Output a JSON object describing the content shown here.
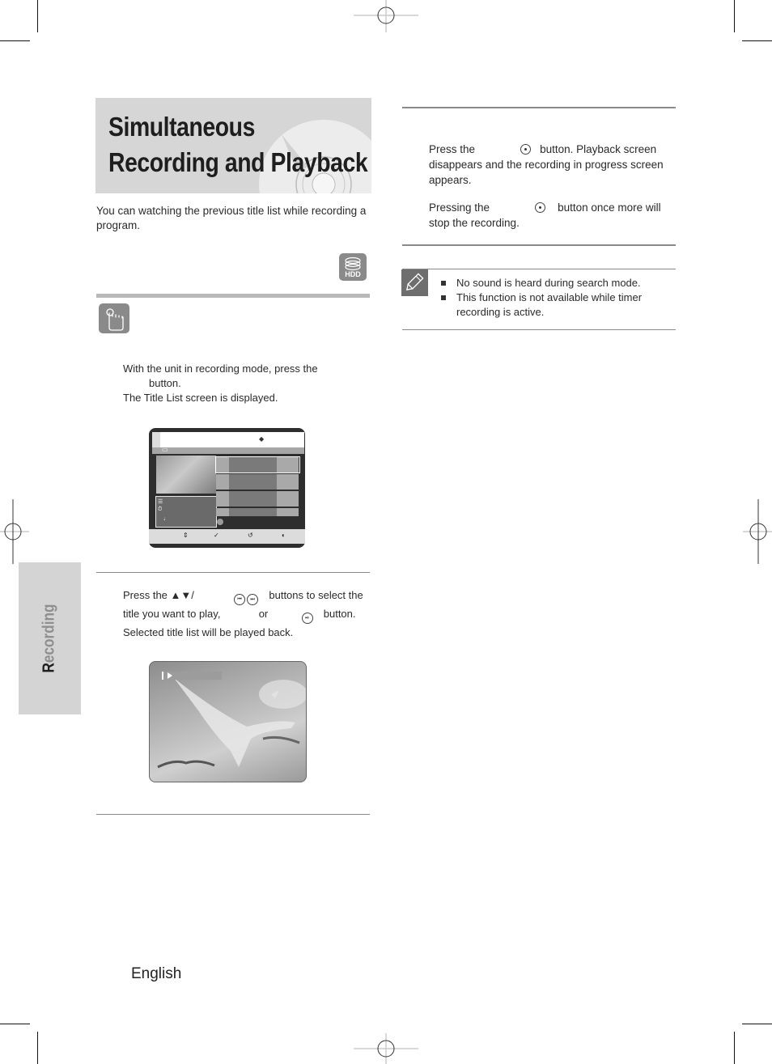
{
  "page": {
    "title_line1": "Simultaneous",
    "title_line2": "Recording and Playback",
    "intro": "You can watching the previous title list while recording a program.",
    "hdd_badge": "HDD",
    "side_tab_first": "R",
    "side_tab_rest": "ecording",
    "footer_language": "English"
  },
  "step1": {
    "line1": "With the unit in recording mode, press the",
    "line2": "button.",
    "line3": "The Title List screen is displayed."
  },
  "title_list_osd": {
    "icons": {
      "nav": "up-down-arrows-icon",
      "select": "select-icon",
      "return": "return-icon",
      "exit": "exit-icon"
    },
    "bottom_symbols": [
      "⇕",
      "✓",
      "↺",
      "◐"
    ],
    "info_symbols": [
      "☰",
      "⏱",
      "♩"
    ],
    "row_count": 4,
    "selected_row": 1
  },
  "step2": {
    "part1": "Press the ▲▼/",
    "part2": "buttons to select the",
    "part3": "title you want to play,",
    "part4": "or",
    "part5": "button.",
    "line3": "Selected title list will be played back."
  },
  "right_col": {
    "p1_start": "Press the",
    "p1_end": "button. Playback screen disappears and the recording in progress screen appears.",
    "p2_start": "Pressing the",
    "p2_end": "button once more will stop the recording."
  },
  "notes": [
    "No sound is heard during search mode.",
    "This function is not available while timer recording is active."
  ],
  "icons": {
    "banner": "disc-icon",
    "hdd": "hdd-stack-icon",
    "hand": "hand-press-icon",
    "note": "pencil-note-icon"
  },
  "colors": {
    "banner_bg": "#d6d6d6",
    "badge_bg": "#8a8a8a",
    "side_tab_bg": "#d4d4d4",
    "osd_dark": "#2e2e2e"
  }
}
